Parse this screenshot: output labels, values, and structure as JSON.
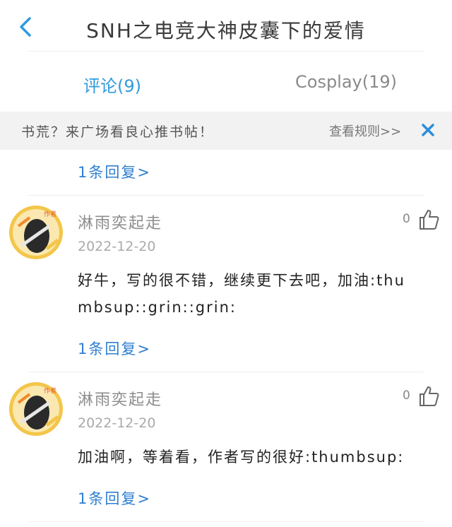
{
  "header": {
    "title": "SNH之电竞大神皮囊下的爱情"
  },
  "tabs": [
    {
      "label": "评论(9)"
    },
    {
      "label": "Cosplay(19)"
    }
  ],
  "notice": {
    "text": "书荒？来广场看良心推书帖！",
    "rules_link": "查看规则>>"
  },
  "top_reply": {
    "label": "1条回复>"
  },
  "comments": [
    {
      "user": "淋雨奕起走",
      "badge": "作者",
      "date": "2022-12-20",
      "likes": "0",
      "text": "好牛，写的很不错，继续更下去吧，加油:thumbsup::grin::grin:",
      "reply_label": "1条回复>"
    },
    {
      "user": "淋雨奕起走",
      "badge": "作者",
      "date": "2022-12-20",
      "likes": "0",
      "text": "加油啊，等着看，作者写的很好:thumbsup:",
      "reply_label": "1条回复>"
    }
  ],
  "colors": {
    "accent": "#2f9be0",
    "link": "#2f7fd1",
    "close": "#2a8fdc"
  },
  "icons": {
    "back": "chevron-left-icon",
    "close": "close-icon",
    "like": "thumbs-up-icon"
  }
}
